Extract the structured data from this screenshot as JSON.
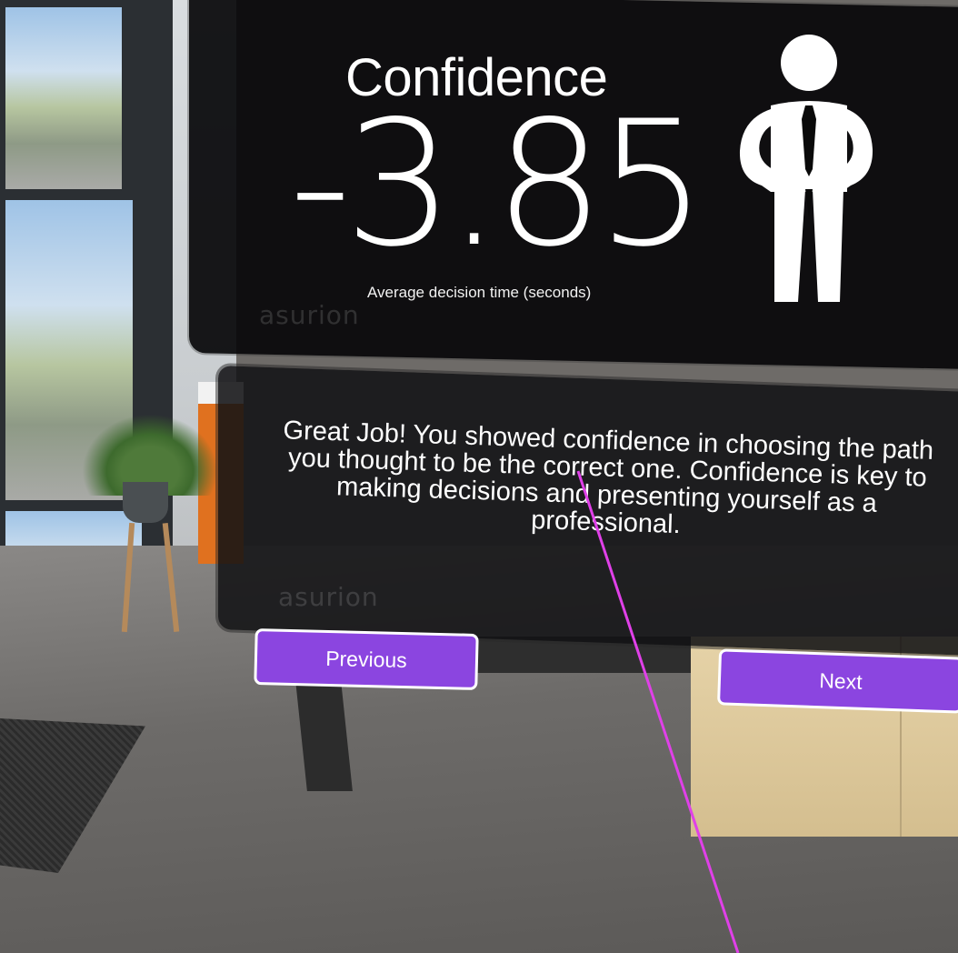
{
  "result": {
    "title": "Confidence",
    "value": "-3.85",
    "caption": "Average decision time (seconds)",
    "feedback": "Great Job! You showed confidence in choosing the path you thought to be the correct one. Confidence is key to making decisions and presenting yourself as a professional."
  },
  "icons": {
    "figure": "confident-person-icon"
  },
  "navigation": {
    "previous_label": "Previous",
    "next_label": "Next"
  },
  "colors": {
    "button": "#8b45e0",
    "pointer": "#e040e8"
  }
}
